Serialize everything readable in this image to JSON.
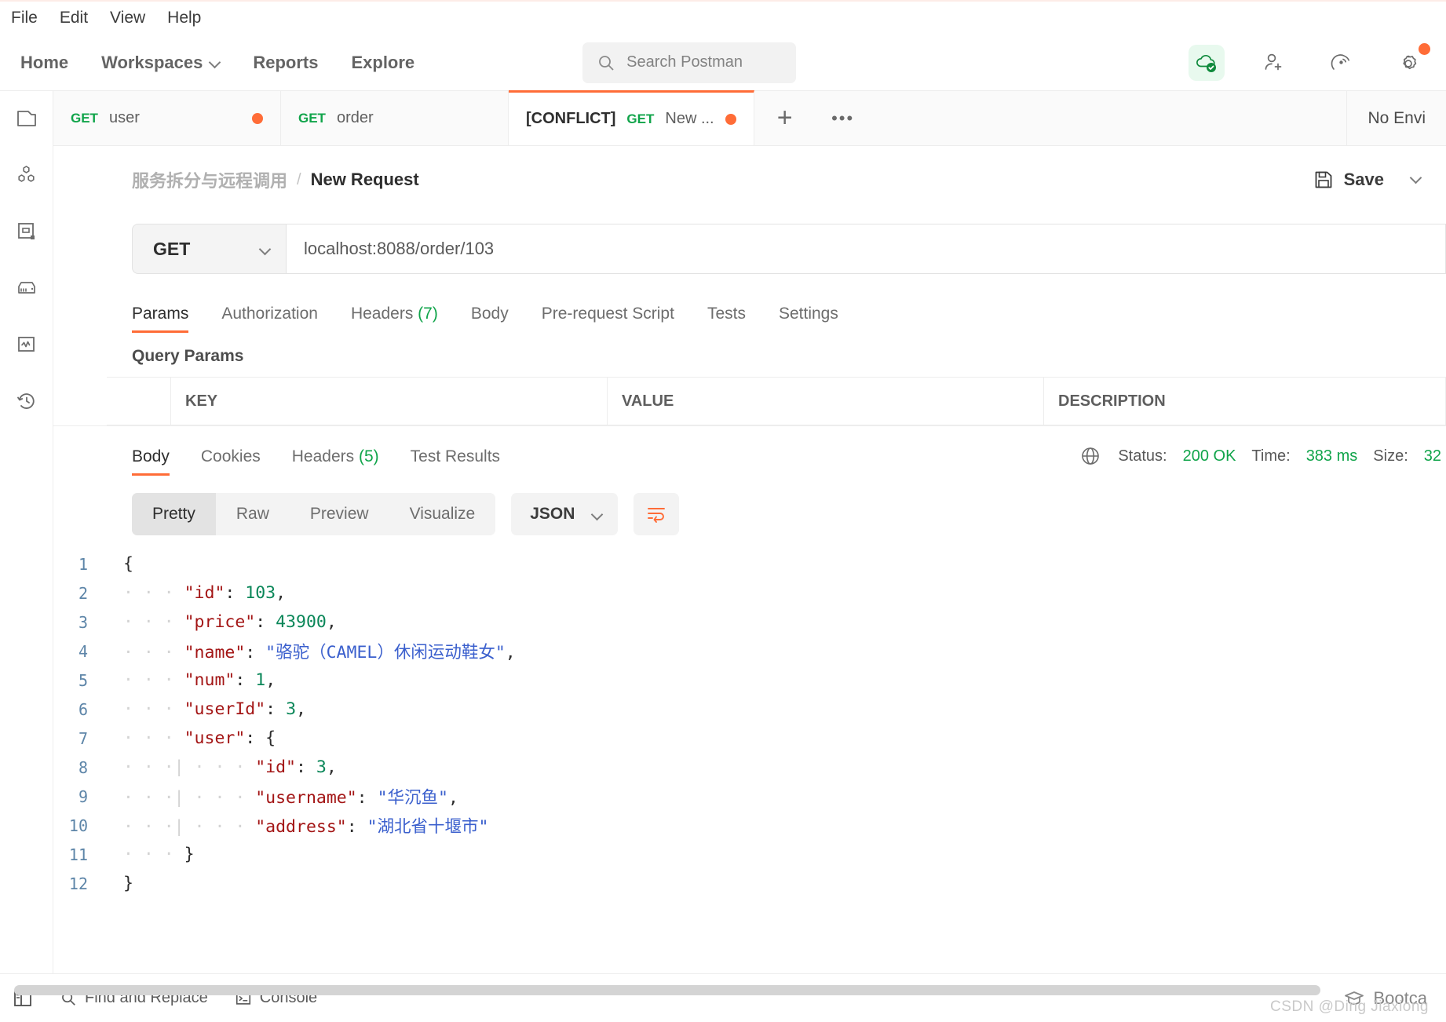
{
  "menubar": {
    "items": [
      "File",
      "Edit",
      "View",
      "Help"
    ]
  },
  "topnav": {
    "items": [
      {
        "label": "Home",
        "has_caret": false
      },
      {
        "label": "Workspaces",
        "has_caret": true
      },
      {
        "label": "Reports",
        "has_caret": false
      },
      {
        "label": "Explore",
        "has_caret": false
      }
    ],
    "search_placeholder": "Search Postman",
    "icons": [
      "cloud-check-icon",
      "invite-user-icon",
      "satellite-icon",
      "settings-gear-icon"
    ],
    "settings_badge_color": "#ff6c37",
    "cloud_badge_color": "#0f8a3c"
  },
  "sidebar": {
    "items": [
      {
        "name": "collections-icon"
      },
      {
        "name": "apis-icon"
      },
      {
        "name": "environments-icon"
      },
      {
        "name": "mock-servers-icon"
      },
      {
        "name": "monitors-icon"
      },
      {
        "name": "history-icon"
      }
    ]
  },
  "tabstrip": {
    "tabs": [
      {
        "prefix": "",
        "method": "GET",
        "title": "user",
        "unsaved": true,
        "active": false
      },
      {
        "prefix": "",
        "method": "GET",
        "title": "order",
        "unsaved": false,
        "active": false
      },
      {
        "prefix": "[CONFLICT]",
        "method": "GET",
        "title": "New ...",
        "unsaved": true,
        "active": true
      }
    ],
    "add_label": "+",
    "more_label": "•••",
    "environment": "No Envi"
  },
  "breadcrumb": {
    "workspace": "服务拆分与远程调用",
    "separator": "/",
    "current": "New Request",
    "save_label": "Save"
  },
  "request": {
    "method": "GET",
    "url": "localhost:8088/order/103",
    "tabs": [
      {
        "label": "Params",
        "count": "",
        "active": true
      },
      {
        "label": "Authorization",
        "count": "",
        "active": false
      },
      {
        "label": "Headers",
        "count": "(7)",
        "active": false
      },
      {
        "label": "Body",
        "count": "",
        "active": false
      },
      {
        "label": "Pre-request Script",
        "count": "",
        "active": false
      },
      {
        "label": "Tests",
        "count": "",
        "active": false
      },
      {
        "label": "Settings",
        "count": "",
        "active": false
      }
    ],
    "query_params_title": "Query Params",
    "param_columns": [
      "KEY",
      "VALUE",
      "DESCRIPTION"
    ]
  },
  "response": {
    "tabs": [
      {
        "label": "Body",
        "count": "",
        "active": true
      },
      {
        "label": "Cookies",
        "count": "",
        "active": false
      },
      {
        "label": "Headers",
        "count": "(5)",
        "active": false
      },
      {
        "label": "Test Results",
        "count": "",
        "active": false
      }
    ],
    "globe_icon": "globe-icon",
    "status_label": "Status:",
    "status_value": "200 OK",
    "time_label": "Time:",
    "time_value": "383 ms",
    "size_label": "Size:",
    "size_value": "32",
    "view_modes": [
      "Pretty",
      "Raw",
      "Preview",
      "Visualize"
    ],
    "active_view_mode": "Pretty",
    "format": "JSON",
    "wrap_icon": "word-wrap-icon",
    "code_lines": [
      {
        "num": "1",
        "indent": 0,
        "fold": true,
        "tokens": [
          {
            "t": "{",
            "c": "p"
          }
        ]
      },
      {
        "num": "2",
        "indent": 1,
        "fold": false,
        "tokens": [
          {
            "t": "\"id\"",
            "c": "k"
          },
          {
            "t": ": ",
            "c": "p"
          },
          {
            "t": "103",
            "c": "n"
          },
          {
            "t": ",",
            "c": "p"
          }
        ]
      },
      {
        "num": "3",
        "indent": 1,
        "fold": false,
        "tokens": [
          {
            "t": "\"price\"",
            "c": "k"
          },
          {
            "t": ": ",
            "c": "p"
          },
          {
            "t": "43900",
            "c": "n"
          },
          {
            "t": ",",
            "c": "p"
          }
        ]
      },
      {
        "num": "4",
        "indent": 1,
        "fold": false,
        "tokens": [
          {
            "t": "\"name\"",
            "c": "k"
          },
          {
            "t": ": ",
            "c": "p"
          },
          {
            "t": "\"骆驼（CAMEL）休闲运动鞋女\"",
            "c": "s"
          },
          {
            "t": ",",
            "c": "p"
          }
        ]
      },
      {
        "num": "5",
        "indent": 1,
        "fold": false,
        "tokens": [
          {
            "t": "\"num\"",
            "c": "k"
          },
          {
            "t": ": ",
            "c": "p"
          },
          {
            "t": "1",
            "c": "n"
          },
          {
            "t": ",",
            "c": "p"
          }
        ]
      },
      {
        "num": "6",
        "indent": 1,
        "fold": false,
        "tokens": [
          {
            "t": "\"userId\"",
            "c": "k"
          },
          {
            "t": ": ",
            "c": "p"
          },
          {
            "t": "3",
            "c": "n"
          },
          {
            "t": ",",
            "c": "p"
          }
        ]
      },
      {
        "num": "7",
        "indent": 1,
        "fold": false,
        "tokens": [
          {
            "t": "\"user\"",
            "c": "k"
          },
          {
            "t": ": ",
            "c": "p"
          },
          {
            "t": "{",
            "c": "p"
          }
        ]
      },
      {
        "num": "8",
        "indent": 2,
        "fold": false,
        "tokens": [
          {
            "t": "\"id\"",
            "c": "k"
          },
          {
            "t": ": ",
            "c": "p"
          },
          {
            "t": "3",
            "c": "n"
          },
          {
            "t": ",",
            "c": "p"
          }
        ]
      },
      {
        "num": "9",
        "indent": 2,
        "fold": false,
        "tokens": [
          {
            "t": "\"username\"",
            "c": "k"
          },
          {
            "t": ": ",
            "c": "p"
          },
          {
            "t": "\"华沉鱼\"",
            "c": "s"
          },
          {
            "t": ",",
            "c": "p"
          }
        ]
      },
      {
        "num": "10",
        "indent": 2,
        "fold": false,
        "tokens": [
          {
            "t": "\"address\"",
            "c": "k"
          },
          {
            "t": ": ",
            "c": "p"
          },
          {
            "t": "\"湖北省十堰市\"",
            "c": "s"
          }
        ]
      },
      {
        "num": "11",
        "indent": 1,
        "fold": false,
        "tokens": [
          {
            "t": "}",
            "c": "p"
          }
        ]
      },
      {
        "num": "12",
        "indent": 0,
        "fold": true,
        "tokens": [
          {
            "t": "}",
            "c": "p"
          }
        ]
      }
    ]
  },
  "bottombar": {
    "left_icon": "sidebar-toggle-icon",
    "items": [
      {
        "icon": "search-icon",
        "label": "Find and Replace"
      },
      {
        "icon": "console-icon",
        "label": "Console"
      }
    ],
    "right_icon": "graduation-cap-icon",
    "right_label": "Bootca"
  },
  "watermark": "CSDN @Ding Jiaxiong"
}
